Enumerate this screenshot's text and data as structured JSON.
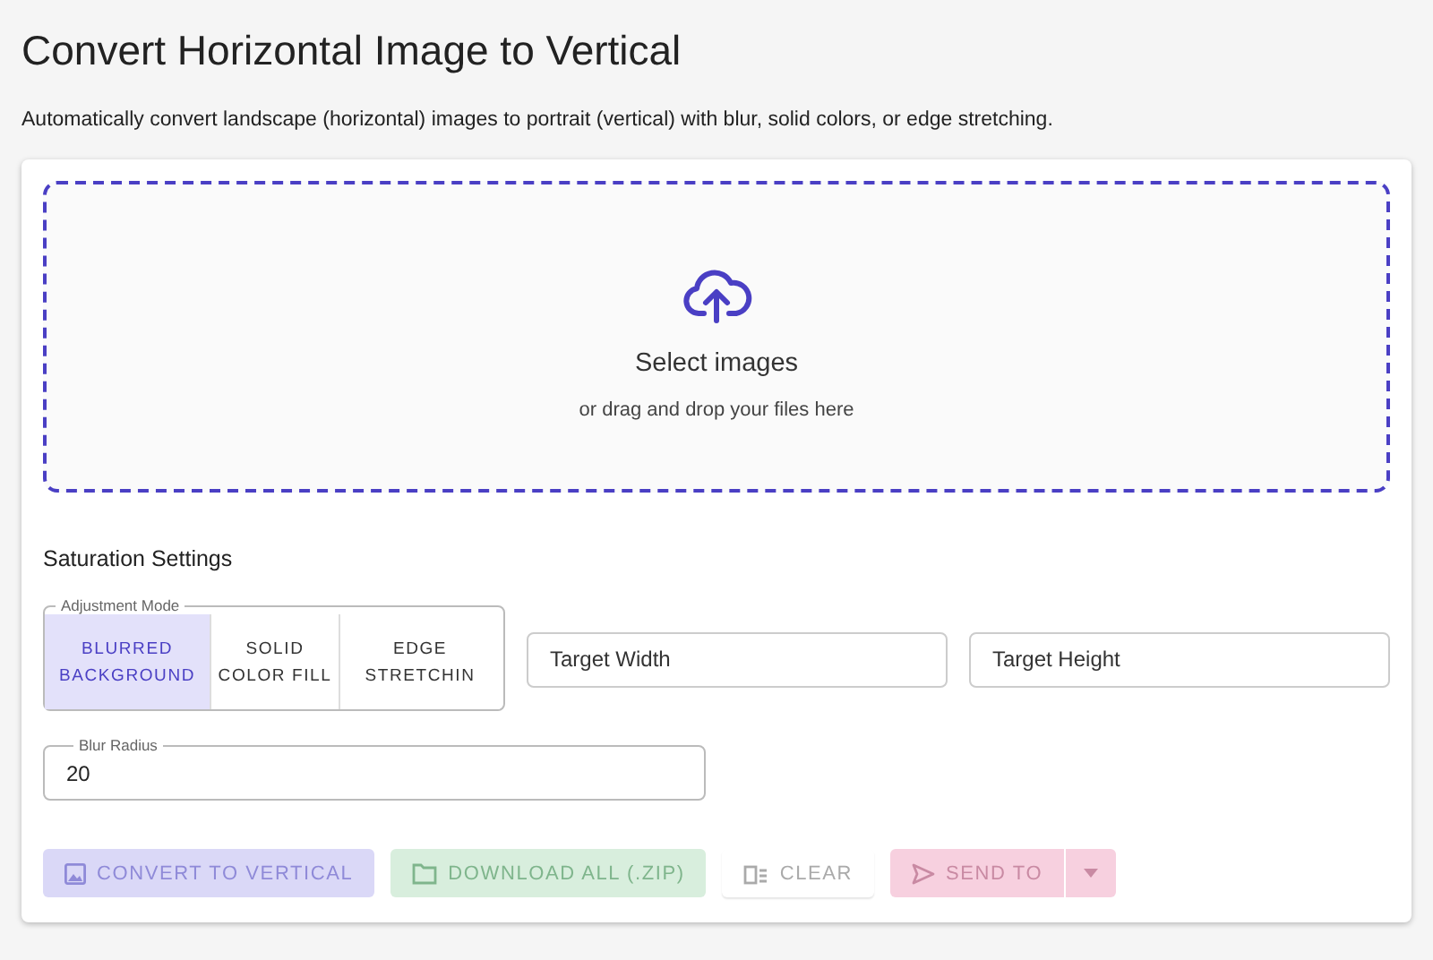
{
  "title": "Convert Horizontal Image to Vertical",
  "description": "Automatically convert landscape (horizontal) images to portrait (vertical) with blur, solid colors, or edge stretching.",
  "dropzone": {
    "title": "Select images",
    "hint": "or drag and drop your files here"
  },
  "settings": {
    "heading": "Saturation Settings",
    "mode": {
      "label": "Adjustment Mode",
      "options": [
        {
          "label": "BLURRED BACKGROUND",
          "selected": true
        },
        {
          "label": "SOLID COLOR FILL",
          "selected": false
        },
        {
          "label": "EDGE STRETCHIN",
          "selected": false
        }
      ]
    },
    "target_width": {
      "placeholder": "Target Width"
    },
    "target_height": {
      "placeholder": "Target Height"
    },
    "blur_radius": {
      "label": "Blur Radius",
      "value": "20"
    }
  },
  "buttons": [
    {
      "kind": "convert",
      "label": "CONVERT TO VERTICAL",
      "disabled": true
    },
    {
      "kind": "download",
      "label": "DOWNLOAD ALL (.ZIP)",
      "disabled": true
    },
    {
      "kind": "clear",
      "label": "CLEAR",
      "disabled": true
    },
    {
      "kind": "send",
      "label": "SEND TO",
      "disabled": true
    }
  ]
}
